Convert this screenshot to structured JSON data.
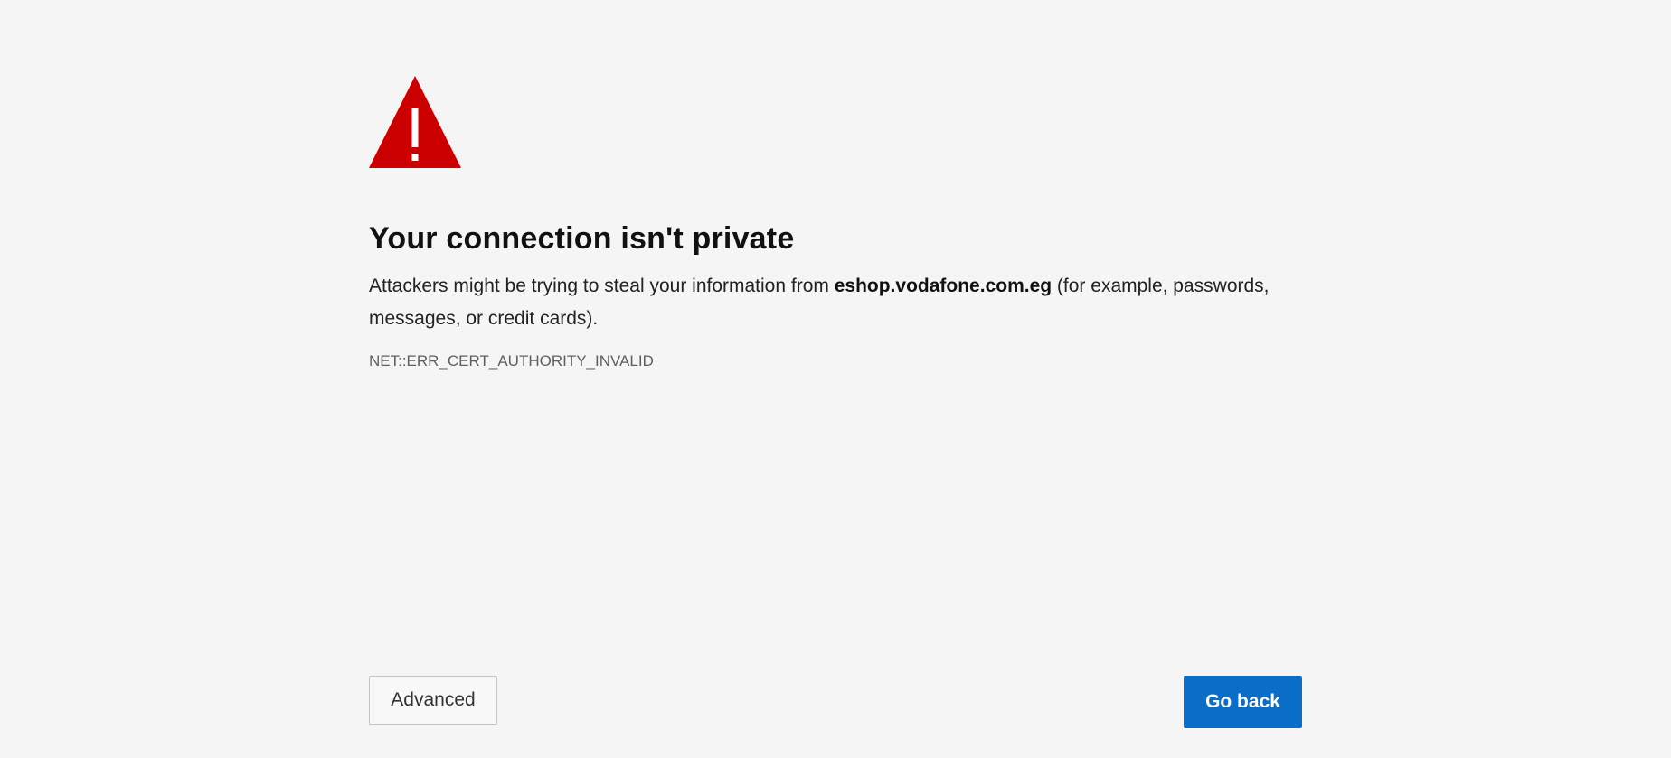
{
  "error_page": {
    "icon": "warning-triangle-icon",
    "title": "Your connection isn't private",
    "message_before": "Attackers might be trying to steal your information from ",
    "domain": "eshop.vodafone.com.eg",
    "message_after": " (for example, passwords, messages, or credit cards).",
    "error_code": "NET::ERR_CERT_AUTHORITY_INVALID"
  },
  "buttons": {
    "advanced_label": "Advanced",
    "go_back_label": "Go back"
  },
  "colors": {
    "background": "#f5f5f5",
    "warning_red": "#cc0000",
    "primary_button": "#0a6ec8"
  }
}
